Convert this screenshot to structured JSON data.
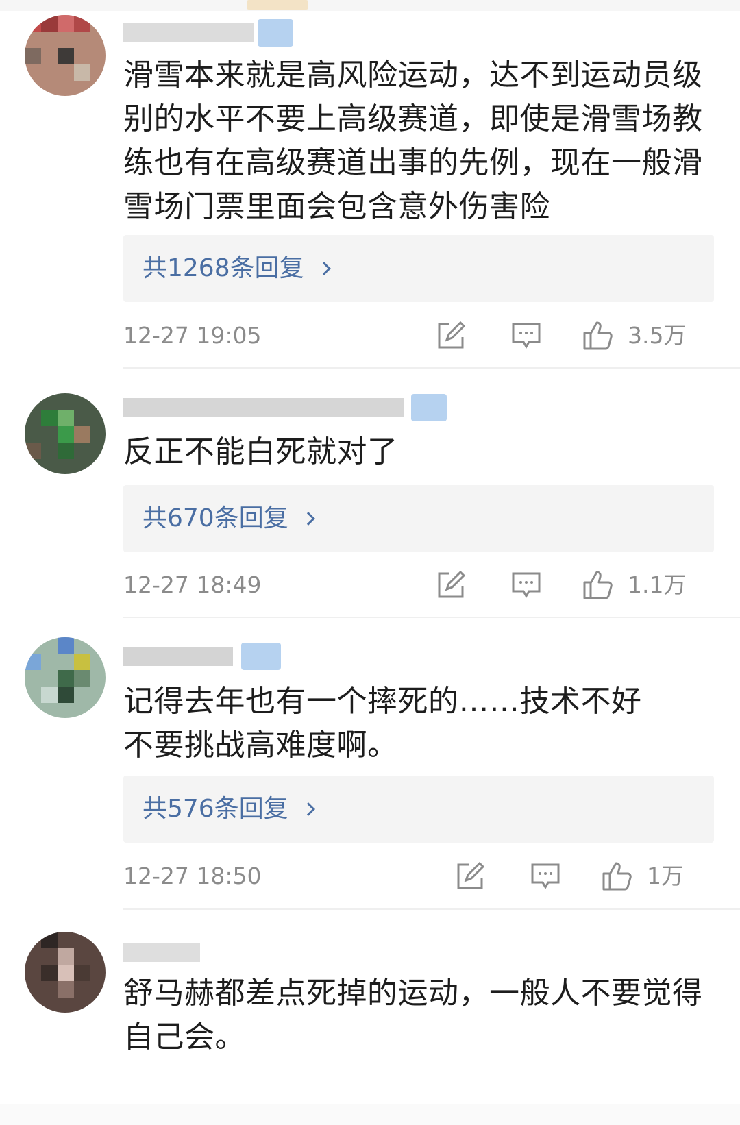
{
  "comments": [
    {
      "text": "滑雪本来就是高风险运动，达不到运动员级别的水平不要上高级赛道，即使是滑雪场教练也有在高级赛道出事的先例，现在一般滑雪场门票里面会包含意外伤害险",
      "replies_label": "共1268条回复",
      "timestamp": "12-27 19:05",
      "likes": "3.5万"
    },
    {
      "text": "反正不能白死就对了",
      "replies_label": "共670条回复",
      "timestamp": "12-27 18:49",
      "likes": "1.1万"
    },
    {
      "text": "记得去年也有一个摔死的……技术不好不要挑战高难度啊。",
      "replies_label": "共576条回复",
      "timestamp": "12-27 18:50",
      "likes": "1万"
    },
    {
      "text": "舒马赫都差点死掉的运动，一般人不要觉得自己会。"
    }
  ],
  "colors": {
    "link": "#4a6ea3",
    "meta_text": "#8b8b8b",
    "reply_box": "#f4f4f4",
    "badge": "#b6d2f0"
  },
  "icons": [
    "share-edit-icon",
    "comment-icon",
    "thumbs-up-icon",
    "chevron-right-icon"
  ]
}
